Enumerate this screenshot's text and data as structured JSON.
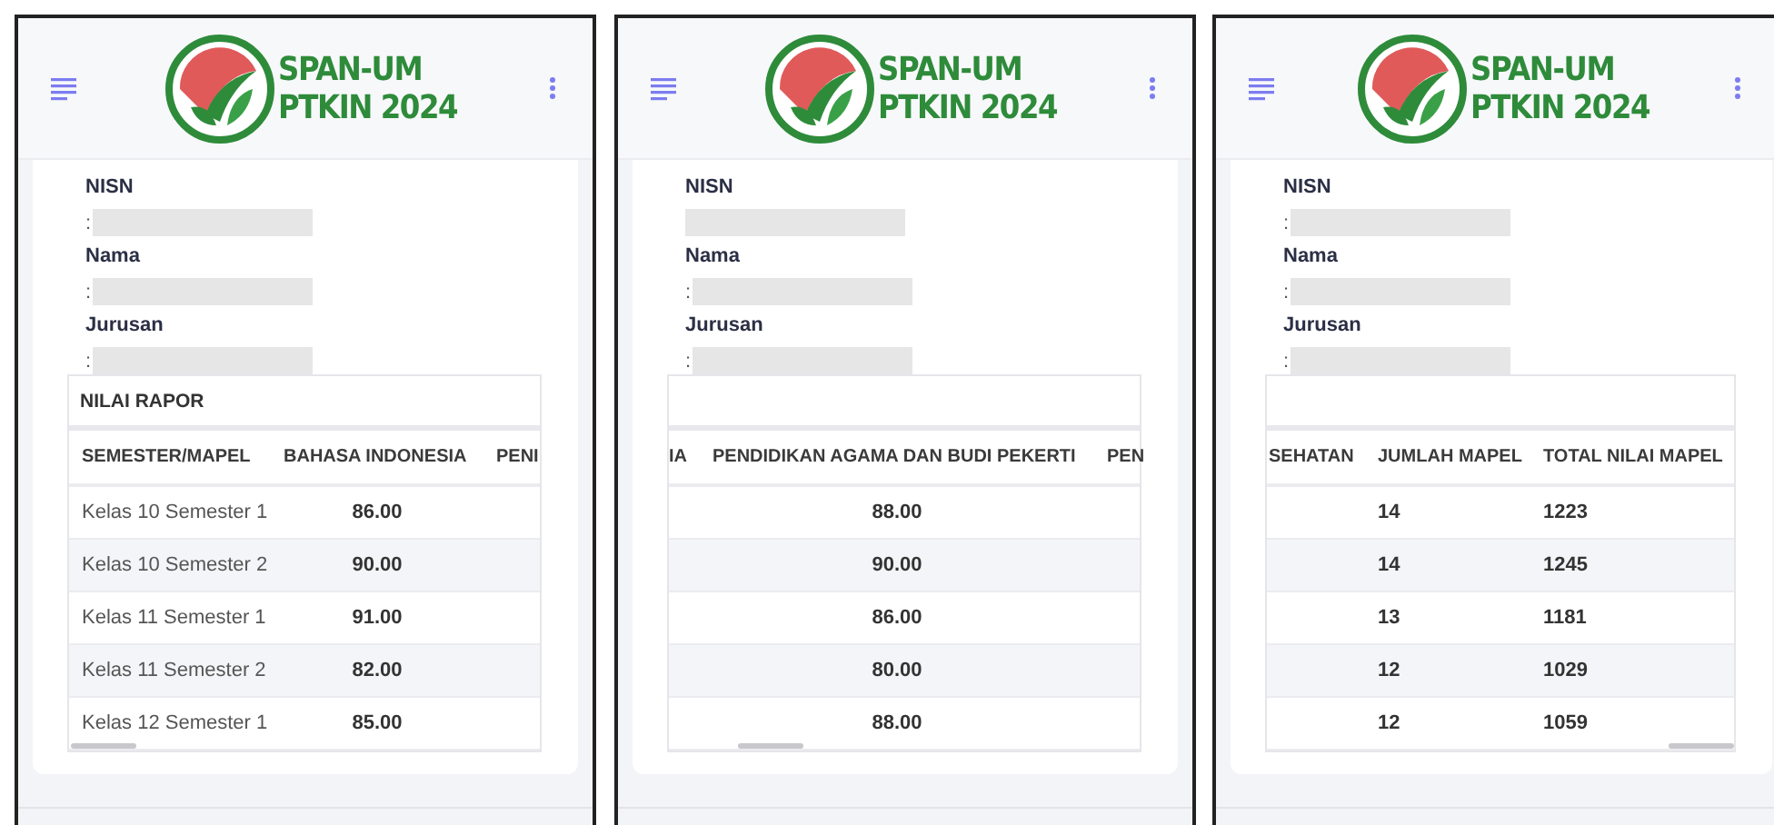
{
  "panels": [
    {
      "header": {
        "logo_lines": [
          "SPAN-UM",
          "PTKIN 2024"
        ]
      },
      "fields": [
        {
          "label": "NISN",
          "value": ":",
          "redacted": true
        },
        {
          "label": "Nama",
          "value": ":",
          "redacted": true
        },
        {
          "label": "Jurusan",
          "value": ":",
          "redacted": true
        }
      ],
      "table": {
        "title": "NILAI RAPOR",
        "columns": [
          {
            "heading": "SEMESTER/MAPEL",
            "kind": "label"
          },
          {
            "heading": "BAHASA INDONESIA",
            "kind": "score"
          },
          {
            "heading": "PENI",
            "kind": "blank"
          }
        ],
        "rows": [
          {
            "values": [
              "Kelas 10 Semester 1",
              "86.00"
            ]
          },
          {
            "values": [
              "Kelas 10 Semester 2",
              "90.00"
            ]
          },
          {
            "values": [
              "Kelas 11 Semester 1",
              "91.00"
            ]
          },
          {
            "values": [
              "Kelas 11 Semester 2",
              "82.00"
            ]
          },
          {
            "values": [
              "Kelas 12 Semester 1",
              "85.00"
            ]
          }
        ]
      }
    },
    {
      "header": {
        "logo_lines": [
          "SPAN-UM",
          "PTKIN 2024"
        ]
      },
      "fields": [
        {
          "label": "NISN",
          "redacted": true
        },
        {
          "label": "Nama",
          "value": ":",
          "redacted": true
        },
        {
          "label": "Jurusan",
          "value": ":",
          "redacted": true
        }
      ],
      "table": {
        "columns": [
          {
            "heading": "IA",
            "kind": "blank"
          },
          {
            "heading": "PENDIDIKAN AGAMA DAN BUDI PEKERTI",
            "kind": "score"
          },
          {
            "heading": "PEN",
            "kind": "blank"
          }
        ],
        "rows": [
          {
            "values": [
              "88.00"
            ]
          },
          {
            "values": [
              "90.00"
            ]
          },
          {
            "values": [
              "86.00"
            ]
          },
          {
            "values": [
              "80.00"
            ]
          },
          {
            "values": [
              "88.00"
            ]
          }
        ]
      }
    },
    {
      "header": {
        "logo_lines": [
          "SPAN-UM",
          "PTKIN 2024"
        ]
      },
      "fields": [
        {
          "label": "NISN",
          "value": ":",
          "redacted": true
        },
        {
          "label": "Nama",
          "value": ":",
          "redacted": true
        },
        {
          "label": "Jurusan",
          "value": ":",
          "redacted": true
        }
      ],
      "table": {
        "columns": [
          {
            "heading": "SEHATAN",
            "kind": "blank"
          },
          {
            "heading": "JUMLAH MAPEL",
            "kind": "count"
          },
          {
            "heading": "TOTAL NILAI MAPEL",
            "kind": "count"
          }
        ],
        "rows": [
          {
            "values": [
              "14",
              "1223"
            ]
          },
          {
            "values": [
              "14",
              "1245"
            ]
          },
          {
            "values": [
              "13",
              "1181"
            ]
          },
          {
            "values": [
              "12",
              "1029"
            ]
          },
          {
            "values": [
              "12",
              "1059"
            ]
          }
        ]
      }
    }
  ]
}
